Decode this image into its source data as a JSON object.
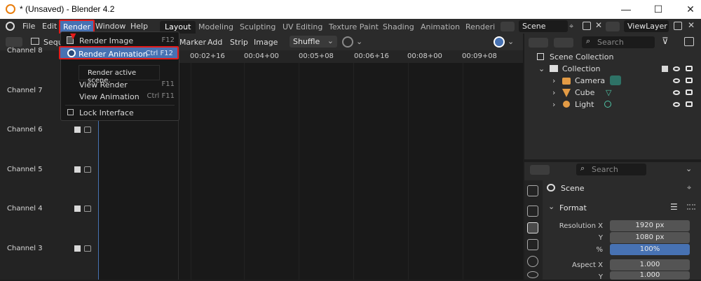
{
  "window": {
    "title": "* (Unsaved) - Blender 4.2",
    "minimize": "—",
    "maximize": "☐",
    "close": "✕"
  },
  "menubar": {
    "file": "File",
    "edit": "Edit",
    "render": "Render",
    "window": "Window",
    "help": "Help"
  },
  "workspaces": [
    "Layout",
    "Modeling",
    "Sculpting",
    "UV Editing",
    "Texture Paint",
    "Shading",
    "Animation",
    "Renderin"
  ],
  "scene_field": "Scene",
  "viewlayer_field": "ViewLayer",
  "seq_header": {
    "editor_label": "Sequ",
    "marker": "Marker",
    "add": "Add",
    "strip": "Strip",
    "image": "Image",
    "shuffle": "Shuffle"
  },
  "ruler_ticks": [
    "00:02+16",
    "00:04+00",
    "00:05+08",
    "00:06+16",
    "00:08+00",
    "00:09+08"
  ],
  "channels": [
    "Channel 8",
    "Channel 7",
    "Channel 6",
    "Channel 5",
    "Channel 4",
    "Channel 3"
  ],
  "render_menu": {
    "items": [
      {
        "label": "Render Image",
        "shortcut": "F12"
      },
      {
        "label": "Render Animation",
        "shortcut": "Ctrl F12"
      },
      {
        "label": "View Render",
        "shortcut": "F11"
      },
      {
        "label": "View Animation",
        "shortcut": "Ctrl F11"
      },
      {
        "label": "Lock Interface",
        "shortcut": ""
      }
    ],
    "tooltip": "Render active scene."
  },
  "outliner": {
    "search_placeholder": "Search",
    "scene_collection": "Scene Collection",
    "collection": "Collection",
    "objects": [
      "Camera",
      "Cube",
      "Light"
    ]
  },
  "properties": {
    "search_placeholder": "Search",
    "scene": "Scene",
    "panel_format": "Format",
    "resolution_x_label": "Resolution X",
    "resolution_x": "1920 px",
    "y_label": "Y",
    "resolution_y": "1080 px",
    "percent_label": "%",
    "percent": "100%",
    "aspect_x_label": "Aspect X",
    "aspect_x": "1.000",
    "aspect_y_label": "Y",
    "aspect_y": "1.000"
  },
  "colors": {
    "accent_blue": "#4772b3",
    "highlight_red": "#e41b1b",
    "orange_icon": "#e39b45"
  }
}
